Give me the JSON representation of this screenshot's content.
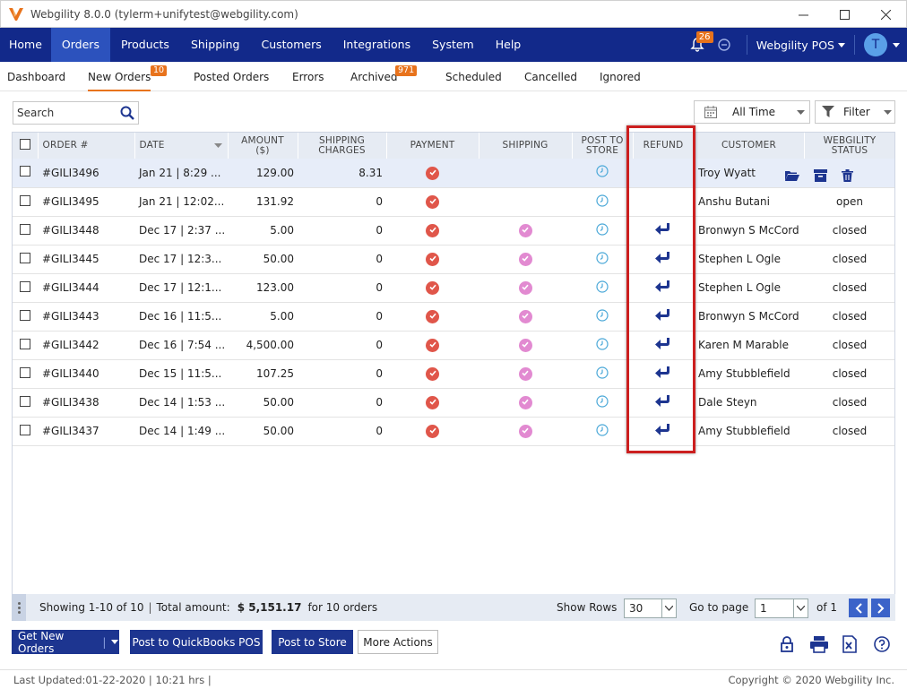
{
  "window": {
    "title": "Webgility 8.0.0 (tylerm+unifytest@webgility.com)"
  },
  "nav": {
    "items": [
      "Home",
      "Orders",
      "Products",
      "Shipping",
      "Customers",
      "Integrations",
      "System",
      "Help"
    ],
    "active": "Orders",
    "notification_count": "26",
    "pos_label": "Webgility POS",
    "avatar_initial": "T"
  },
  "subtabs": {
    "items": [
      {
        "label": "Dashboard",
        "badge": ""
      },
      {
        "label": "New Orders",
        "badge": "10"
      },
      {
        "label": "Posted Orders",
        "badge": ""
      },
      {
        "label": "Errors",
        "badge": ""
      },
      {
        "label": "Archived",
        "badge": "971"
      },
      {
        "label": "Scheduled",
        "badge": ""
      },
      {
        "label": "Cancelled",
        "badge": ""
      },
      {
        "label": "Ignored",
        "badge": ""
      }
    ],
    "active": "New Orders"
  },
  "toolbar": {
    "search_placeholder": "Search",
    "date_range": "All Time",
    "filter_label": "Filter"
  },
  "table": {
    "headers": {
      "order": "ORDER #",
      "date": "DATE",
      "amount": "AMOUNT\n($)",
      "shipping_charges": "SHIPPING\nCHARGES",
      "payment": "PAYMENT",
      "shipping": "SHIPPING",
      "post_to_store": "POST TO\nSTORE",
      "refund": "REFUND",
      "customer": "CUSTOMER",
      "status": "WEBGILITY\nSTATUS"
    },
    "rows": [
      {
        "order": "#GILI3496",
        "date": "Jan 21 | 8:29 ...",
        "amount": "129.00",
        "shipping_charges": "8.31",
        "payment": true,
        "shipping": false,
        "post": true,
        "refund": false,
        "customer": "Troy Wyatt",
        "status": ""
      },
      {
        "order": "#GILI3495",
        "date": "Jan 21 | 12:02...",
        "amount": "131.92",
        "shipping_charges": "0",
        "payment": true,
        "shipping": false,
        "post": true,
        "refund": false,
        "customer": "Anshu Butani",
        "status": "open"
      },
      {
        "order": "#GILI3448",
        "date": "Dec 17 | 2:37 ...",
        "amount": "5.00",
        "shipping_charges": "0",
        "payment": true,
        "shipping": true,
        "post": true,
        "refund": true,
        "customer": "Bronwyn S McCord",
        "status": "closed"
      },
      {
        "order": "#GILI3445",
        "date": "Dec 17 | 12:3...",
        "amount": "50.00",
        "shipping_charges": "0",
        "payment": true,
        "shipping": true,
        "post": true,
        "refund": true,
        "customer": "Stephen L Ogle",
        "status": "closed"
      },
      {
        "order": "#GILI3444",
        "date": "Dec 17 | 12:1...",
        "amount": "123.00",
        "shipping_charges": "0",
        "payment": true,
        "shipping": true,
        "post": true,
        "refund": true,
        "customer": "Stephen L Ogle",
        "status": "closed"
      },
      {
        "order": "#GILI3443",
        "date": "Dec 16 | 11:5...",
        "amount": "5.00",
        "shipping_charges": "0",
        "payment": true,
        "shipping": true,
        "post": true,
        "refund": true,
        "customer": "Bronwyn S McCord",
        "status": "closed"
      },
      {
        "order": "#GILI3442",
        "date": "Dec 16 | 7:54 ...",
        "amount": "4,500.00",
        "shipping_charges": "0",
        "payment": true,
        "shipping": true,
        "post": true,
        "refund": true,
        "customer": "Karen M Marable",
        "status": "closed"
      },
      {
        "order": "#GILI3440",
        "date": "Dec 15 | 11:5...",
        "amount": "107.25",
        "shipping_charges": "0",
        "payment": true,
        "shipping": true,
        "post": true,
        "refund": true,
        "customer": "Amy Stubblefield",
        "status": "closed"
      },
      {
        "order": "#GILI3438",
        "date": "Dec 14 | 1:53 ...",
        "amount": "50.00",
        "shipping_charges": "0",
        "payment": true,
        "shipping": true,
        "post": true,
        "refund": true,
        "customer": "Dale Steyn",
        "status": "closed"
      },
      {
        "order": "#GILI3437",
        "date": "Dec 14 | 1:49 ...",
        "amount": "50.00",
        "shipping_charges": "0",
        "payment": true,
        "shipping": true,
        "post": true,
        "refund": true,
        "customer": "Amy Stubblefield",
        "status": "closed"
      }
    ]
  },
  "footer": {
    "showing": "Showing 1-10 of 10",
    "total_label": "Total amount:",
    "total_value": "$ 5,151.17",
    "total_suffix": "for 10 orders",
    "show_rows_label": "Show Rows",
    "show_rows_value": "30",
    "goto_label": "Go to page",
    "page_value": "1",
    "of_pages": "of 1"
  },
  "actions": {
    "get_new_orders": "Get New Orders",
    "post_quickbooks": "Post to QuickBooks POS",
    "post_store": "Post to Store",
    "more_actions": "More Actions"
  },
  "status": {
    "last_updated": "Last Updated:01-22-2020 | 10:21 hrs |",
    "copyright": "Copyright © 2020 Webgility Inc."
  },
  "icons": {
    "payment": "check-circle-icon",
    "shipping": "check-circle-icon",
    "post": "clock-icon",
    "refund": "refund-arrow-icon"
  },
  "colors": {
    "nav_bg": "#12298a",
    "accent": "#e8731c",
    "highlight": "#cc1f1f",
    "payment_red": "#e0564a",
    "shipping_pink": "#e28ad1"
  }
}
